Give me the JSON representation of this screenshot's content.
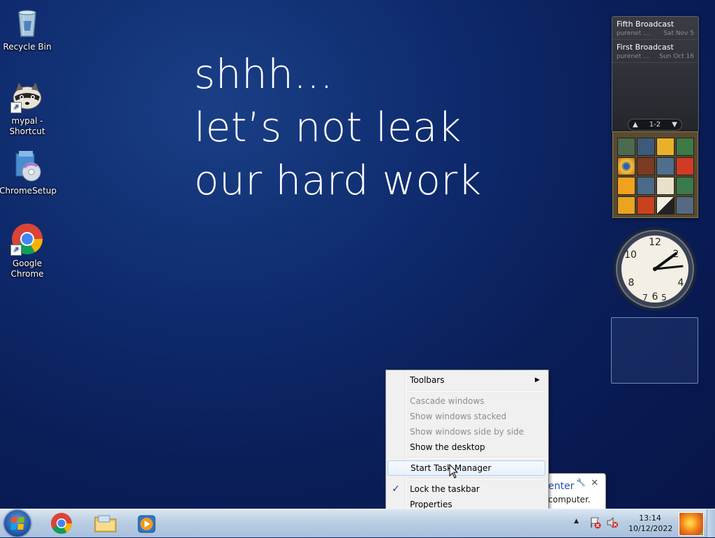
{
  "desktop_icons": [
    {
      "label": "Recycle Bin",
      "icon": "recycle-bin-icon"
    },
    {
      "label": "mypal - Shortcut",
      "icon": "mypal-raccoon-icon"
    },
    {
      "label": "ChromeSetup",
      "icon": "installer-icon"
    },
    {
      "label": "Google Chrome",
      "icon": "chrome-icon"
    }
  ],
  "wallpaper_text": [
    "shhh...",
    "let’s not leak",
    "our hard work"
  ],
  "feed_gadget": {
    "items": [
      {
        "title": "Fifth Broadcast",
        "source": "purenet ...",
        "date": "Sat Nov 5"
      },
      {
        "title": "First Broadcast",
        "source": "purenet ...",
        "date": "Sun Oct 16"
      }
    ],
    "pager": "1-2"
  },
  "clock_gadget": {
    "time": "13:14"
  },
  "balloon": {
    "title": "enter",
    "body": "computer."
  },
  "context_menu": {
    "items": [
      {
        "label": "Toolbars",
        "enabled": true,
        "submenu": true
      },
      {
        "label": "Cascade windows",
        "enabled": false
      },
      {
        "label": "Show windows stacked",
        "enabled": false
      },
      {
        "label": "Show windows side by side",
        "enabled": false
      },
      {
        "label": "Show the desktop",
        "enabled": true
      },
      {
        "label": "Start Task Manager",
        "enabled": true,
        "highlighted": true
      },
      {
        "label": "Lock the taskbar",
        "enabled": true,
        "checked": true
      },
      {
        "label": "Properties",
        "enabled": true
      }
    ]
  },
  "taskbar": {
    "pinned": [
      "chrome-icon",
      "explorer-folder-icon",
      "media-player-icon"
    ],
    "tray": {
      "time": "13:14",
      "date": "10/12/2022"
    }
  },
  "colors": {
    "accent": "#1e4fb4",
    "desktop": "#0e2a6c"
  }
}
